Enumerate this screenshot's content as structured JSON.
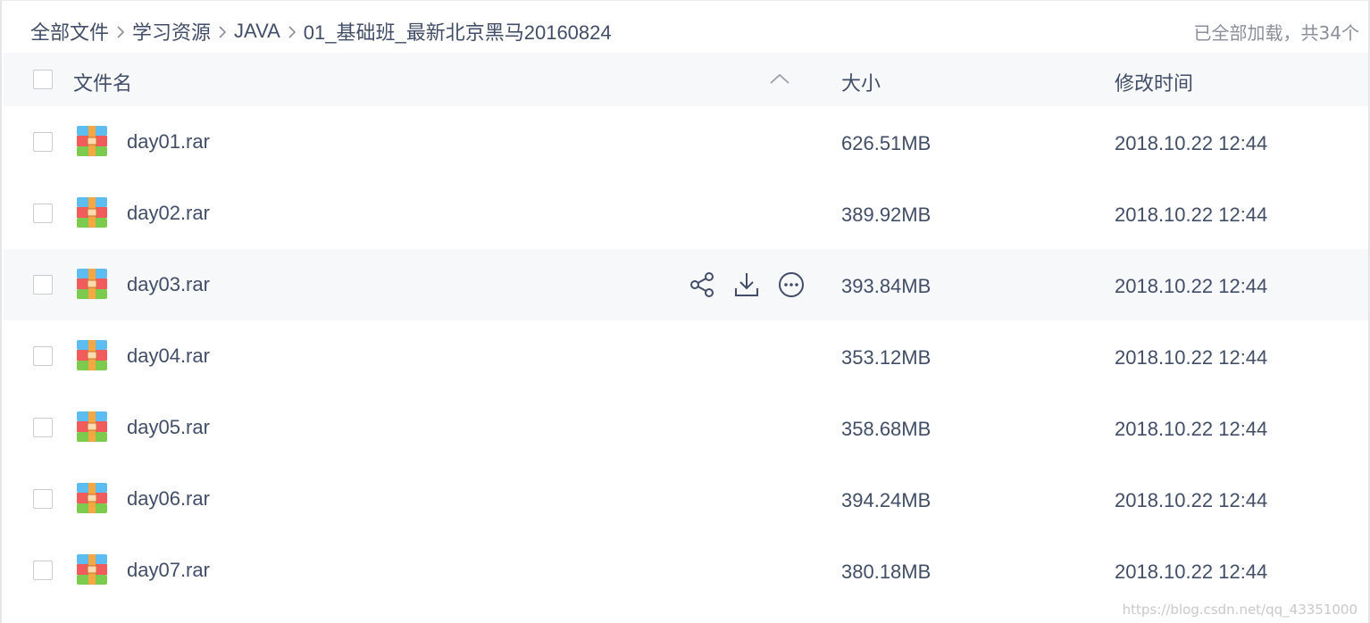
{
  "breadcrumb": {
    "items": [
      "全部文件",
      "学习资源",
      "JAVA",
      "01_基础班_最新北京黑马20160824"
    ]
  },
  "load_status": "已全部加载，共34个",
  "table": {
    "columns": {
      "name": "文件名",
      "size": "大小",
      "modified": "修改时间"
    },
    "rows": [
      {
        "name": "day01.rar",
        "size": "626.51MB",
        "modified": "2018.10.22 12:44"
      },
      {
        "name": "day02.rar",
        "size": "389.92MB",
        "modified": "2018.10.22 12:44"
      },
      {
        "name": "day03.rar",
        "size": "393.84MB",
        "modified": "2018.10.22 12:44"
      },
      {
        "name": "day04.rar",
        "size": "353.12MB",
        "modified": "2018.10.22 12:44"
      },
      {
        "name": "day05.rar",
        "size": "358.68MB",
        "modified": "2018.10.22 12:44"
      },
      {
        "name": "day06.rar",
        "size": "394.24MB",
        "modified": "2018.10.22 12:44"
      },
      {
        "name": "day07.rar",
        "size": "380.18MB",
        "modified": "2018.10.22 12:44"
      }
    ],
    "hover_row_index": 2,
    "hover_actions": [
      "share-icon",
      "download-icon",
      "more-icon"
    ]
  },
  "icons": {
    "file_type": "archive-icon",
    "sort": "chevron-up-icon",
    "separator": "chevron-right-icon"
  },
  "colors": {
    "text": "#424e67",
    "muted": "#8a8f99",
    "header_bg": "#f7f8fa",
    "hover_bg": "#f7f8fa"
  },
  "watermark": "https://blog.csdn.net/qq_43351000"
}
